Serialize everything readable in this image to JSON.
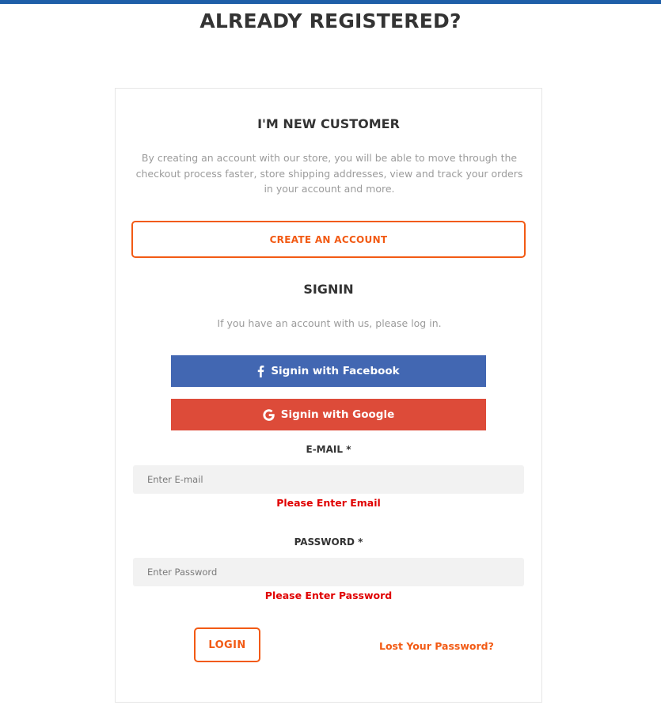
{
  "page": {
    "title": "ALREADY REGISTERED?"
  },
  "new_customer": {
    "heading": "I'M NEW CUSTOMER",
    "description": "By creating an account with our store, you will be able to move through the checkout process faster, store shipping addresses, view and track your orders in your account and more.",
    "create_button": "CREATE AN ACCOUNT"
  },
  "signin": {
    "heading": "SIGNIN",
    "description": "If you have an account with us, please log in.",
    "facebook_button": "Signin with Facebook",
    "google_button": "Signin with Google",
    "email": {
      "label": "E-MAIL *",
      "placeholder": "Enter E-mail",
      "value": "",
      "error": "Please Enter Email"
    },
    "password": {
      "label": "PASSWORD *",
      "placeholder": "Enter Password",
      "value": "",
      "error": "Please Enter Password"
    },
    "login_button": "LOGIN",
    "lost_password_link": "Lost Your Password?"
  },
  "icons": {
    "facebook": "facebook-icon",
    "google": "google-icon"
  },
  "colors": {
    "top_bar": "#1f5fa8",
    "accent_orange": "#f25a14",
    "facebook_blue": "#4267b2",
    "google_red": "#dd4b39",
    "error_red": "#e00000"
  }
}
